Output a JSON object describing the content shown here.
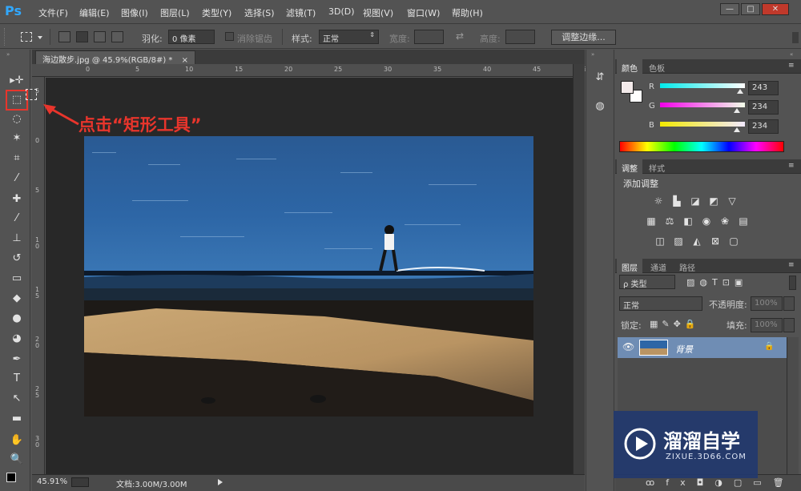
{
  "app": {
    "logo": "Ps",
    "menus": [
      "文件(F)",
      "编辑(E)",
      "图像(I)",
      "图层(L)",
      "类型(Y)",
      "选择(S)",
      "滤镜(T)",
      "3D(D)",
      "视图(V)",
      "窗口(W)",
      "帮助(H)"
    ],
    "window_controls": [
      "—",
      "□",
      "✕"
    ]
  },
  "options": {
    "feather_label": "羽化:",
    "feather_value": "0 像素",
    "antialias_label": "消除锯齿",
    "style_label": "样式:",
    "style_value": "正常",
    "width_label": "宽度:",
    "height_label": "高度:",
    "refine_edge_button": "调整边缘..."
  },
  "document": {
    "tab_title": "海边散步.jpg @ 45.9%(RGB/8#) *",
    "tab_close": "×",
    "ruler_h": [
      "0",
      "5",
      "10",
      "15",
      "20",
      "25",
      "30",
      "35",
      "40",
      "45",
      "50"
    ],
    "ruler_v": [
      "5",
      "0",
      "5",
      "1 0",
      "1 5",
      "2 0",
      "2 5",
      "3 0"
    ],
    "zoom": "45.91%",
    "doc_size": "文档:3.00M/3.00M"
  },
  "annotation": {
    "text": "点击“矩形工具”",
    "color": "#e8352c"
  },
  "tools": [
    {
      "name": "move-icon",
      "glyph": "▸✛"
    },
    {
      "name": "rect-marquee-icon",
      "glyph": "⬚"
    },
    {
      "name": "lasso-icon",
      "glyph": "◌"
    },
    {
      "name": "magic-wand-icon",
      "glyph": "✶"
    },
    {
      "name": "crop-icon",
      "glyph": "⌗"
    },
    {
      "name": "eyedropper-icon",
      "glyph": "⁄"
    },
    {
      "name": "healing-brush-icon",
      "glyph": "✚"
    },
    {
      "name": "brush-icon",
      "glyph": "⁄"
    },
    {
      "name": "clone-stamp-icon",
      "glyph": "⊥"
    },
    {
      "name": "history-brush-icon",
      "glyph": "↺"
    },
    {
      "name": "eraser-icon",
      "glyph": "▭"
    },
    {
      "name": "paint-bucket-icon",
      "glyph": "◆"
    },
    {
      "name": "blur-icon",
      "glyph": "●"
    },
    {
      "name": "dodge-icon",
      "glyph": "◕"
    },
    {
      "name": "pen-icon",
      "glyph": "✒"
    },
    {
      "name": "type-icon",
      "glyph": "T"
    },
    {
      "name": "path-select-icon",
      "glyph": "↖"
    },
    {
      "name": "rectangle-shape-icon",
      "glyph": "▬"
    },
    {
      "name": "hand-icon",
      "glyph": "✋"
    },
    {
      "name": "zoom-icon",
      "glyph": "🔍"
    }
  ],
  "color_panel": {
    "tabs": [
      "颜色",
      "色板"
    ],
    "channels": [
      {
        "label": "R",
        "value": "243"
      },
      {
        "label": "G",
        "value": "234"
      },
      {
        "label": "B",
        "value": "234"
      }
    ],
    "foreground": "#f3eaea",
    "background": "#ffffff"
  },
  "adjustments_panel": {
    "tabs": [
      "调整",
      "样式"
    ],
    "heading": "添加调整"
  },
  "layers_panel": {
    "tabs": [
      "图层",
      "通道",
      "路径"
    ],
    "filter_label": "ρ 类型",
    "blend_mode": "正常",
    "opacity_label": "不透明度:",
    "opacity_value": "100%",
    "lock_label": "锁定:",
    "fill_label": "填充:",
    "fill_value": "100%",
    "layer_name": "背景"
  },
  "watermark": {
    "title": "溜溜自学",
    "url": "ZIXUE.3D66.COM"
  }
}
